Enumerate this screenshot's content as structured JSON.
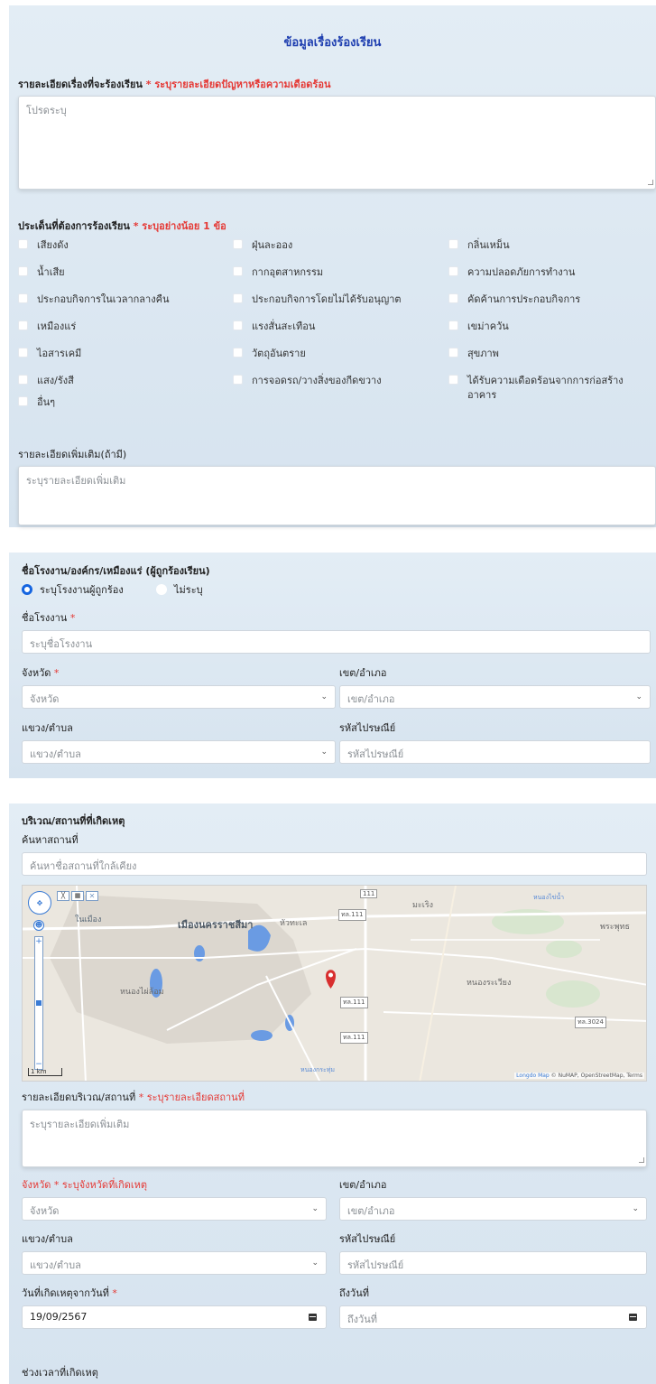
{
  "complaint": {
    "title": "ข้อมูลเรื่องร้องเรียน",
    "detail_label": "รายละเอียดเรื่องที่จะร้องเรียน",
    "detail_required_note": "ระบุรายละเอียดปัญหาหรือความเดือดร้อน",
    "detail_placeholder": "โปรดระบุ",
    "issues_label": "ประเด็นที่ต้องการร้องเรียน",
    "issues_required_note": "ระบุอย่างน้อย 1 ข้อ",
    "issues": [
      "เสียงดัง",
      "ฝุ่นละออง",
      "กลิ่นเหม็น",
      "น้ำเสีย",
      "กากอุตสาหกรรม",
      "ความปลอดภัยการทำงาน",
      "ประกอบกิจการในเวลากลางคืน",
      "ประกอบกิจการโดยไม่ได้รับอนุญาต",
      "คัดค้านการประกอบกิจการ",
      "เหมืองแร่",
      "แรงสั่นสะเทือน",
      "เขม่าควัน",
      "ไอสารเคมี",
      "วัตถุอันตราย",
      "สุขภาพ",
      "แสง/รังสี",
      "การจอดรถ/วางสิ่งของกีดขวาง",
      "ได้รับความเดือดร้อนจากการก่อสร้างอาคาร",
      "อื่นๆ"
    ],
    "extra_label": "รายละเอียดเพิ่มเติม(ถ้ามี)",
    "extra_placeholder": "ระบุรายละเอียดเพิ่มเติม"
  },
  "factory": {
    "title": "ชื่อโรงงาน/องค์กร/เหมืองแร่ (ผู้ถูกร้องเรียน)",
    "radio_specify": "ระบุโรงงานผู้ถูกร้อง",
    "radio_unspecified": "ไม่ระบุ",
    "name_label": "ชื่อโรงงาน",
    "name_placeholder": "ระบุชื่อโรงงาน",
    "province_label": "จังหวัด",
    "province_placeholder": "จังหวัด",
    "district_label": "เขต/อำเภอ",
    "district_placeholder": "เขต/อำเภอ",
    "subdistrict_label": "แขวง/ตำบล",
    "subdistrict_placeholder": "แขวง/ตำบล",
    "postal_label": "รหัสไปรษณีย์",
    "postal_placeholder": "รหัสไปรษณีย์"
  },
  "location": {
    "title": "บริเวณ/สถานที่ที่เกิดเหตุ",
    "search_label": "ค้นหาสถานที่",
    "search_placeholder": "ค้นหาชื่อสถานที่ใกล้เคียง",
    "map": {
      "labels": [
        "ในเมือง",
        "เมืองนครราชสีมา",
        "หัวทะเล",
        "หนองไผ่ล้อม",
        "มะเริง",
        "หนองระเวียง",
        "พระพุทธ",
        "หนองไข่น้ำ",
        "หนองกระทุ่ม"
      ],
      "roads": [
        "ทล.111",
        "ทล.111",
        "ทล.111",
        "ทล.3024",
        "111"
      ],
      "scale": "1 km",
      "attribution": "© NuMAP, OpenStreetMap, Terms",
      "brand": "Longdo Map"
    },
    "detail_label": "รายละเอียดบริเวณ/สถานที่",
    "detail_required_note": "ระบุรายละเอียดสถานที่",
    "detail_placeholder": "ระบุรายละเอียดเพิ่มเติม",
    "province_label": "จังหวัด",
    "province_required_note": "ระบุจังหวัดที่เกิดเหตุ",
    "province_placeholder": "จังหวัด",
    "district_label": "เขต/อำเภอ",
    "district_placeholder": "เขต/อำเภอ",
    "subdistrict_label": "แขวง/ตำบล",
    "subdistrict_placeholder": "แขวง/ตำบล",
    "postal_label": "รหัสไปรษณีย์",
    "postal_placeholder": "รหัสไปรษณีย์",
    "date_from_label": "วันที่เกิดเหตุจากวันที่",
    "date_from_value": "19/09/2567",
    "date_to_label": "ถึงวันที่",
    "date_to_placeholder": "ถึงวันที่",
    "time_label": "ช่วงเวลาที่เกิดเหตุ"
  },
  "colors": {
    "accent": "#1f3fb0",
    "required": "#e53935",
    "panel_bg": "#dde8f2",
    "radio": "#1565e0"
  }
}
